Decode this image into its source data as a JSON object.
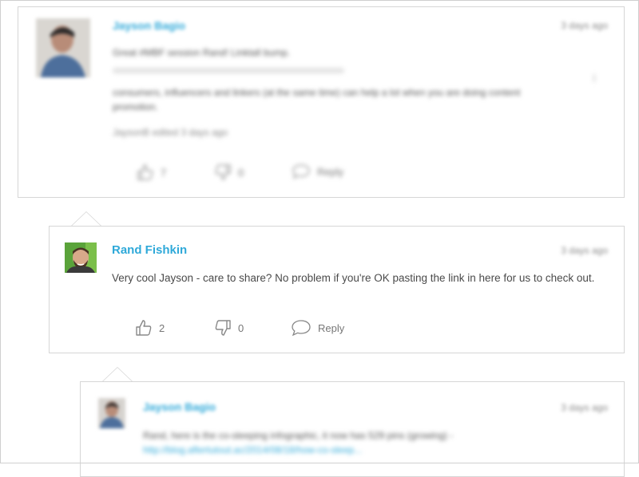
{
  "comments": [
    {
      "author": "Jayson Bagio",
      "time": "3 days ago",
      "lines": [
        "Great #MBF session Rand! Linktall bump.",
        "consumers, influencers and linkers (at the same time) can help a lot when you are doing content",
        "promotion."
      ],
      "edited": "JaysonB edited 3 days ago",
      "likes": "7",
      "dislikes": "0",
      "reply_label": "Reply"
    },
    {
      "author": "Rand Fishkin",
      "time": "3 days ago",
      "text": "Very cool Jayson - care to share? No problem if you're OK pasting the link in here for us to check out.",
      "likes": "2",
      "dislikes": "0",
      "reply_label": "Reply"
    },
    {
      "author": "Jayson Bagio",
      "time": "3 days ago",
      "text": "Rand, here is the co-sleeping infographic, it now has 529 pins (growing) -",
      "link": "http://blog.aftertutout.ac/2014/08/18/how-co-sleep..."
    }
  ],
  "colors": {
    "link": "#2fa9d9",
    "border": "#d6d6d6",
    "muted": "#888888"
  },
  "icons": [
    "thumbs-up-icon",
    "thumbs-down-icon",
    "reply-bubble-icon"
  ]
}
